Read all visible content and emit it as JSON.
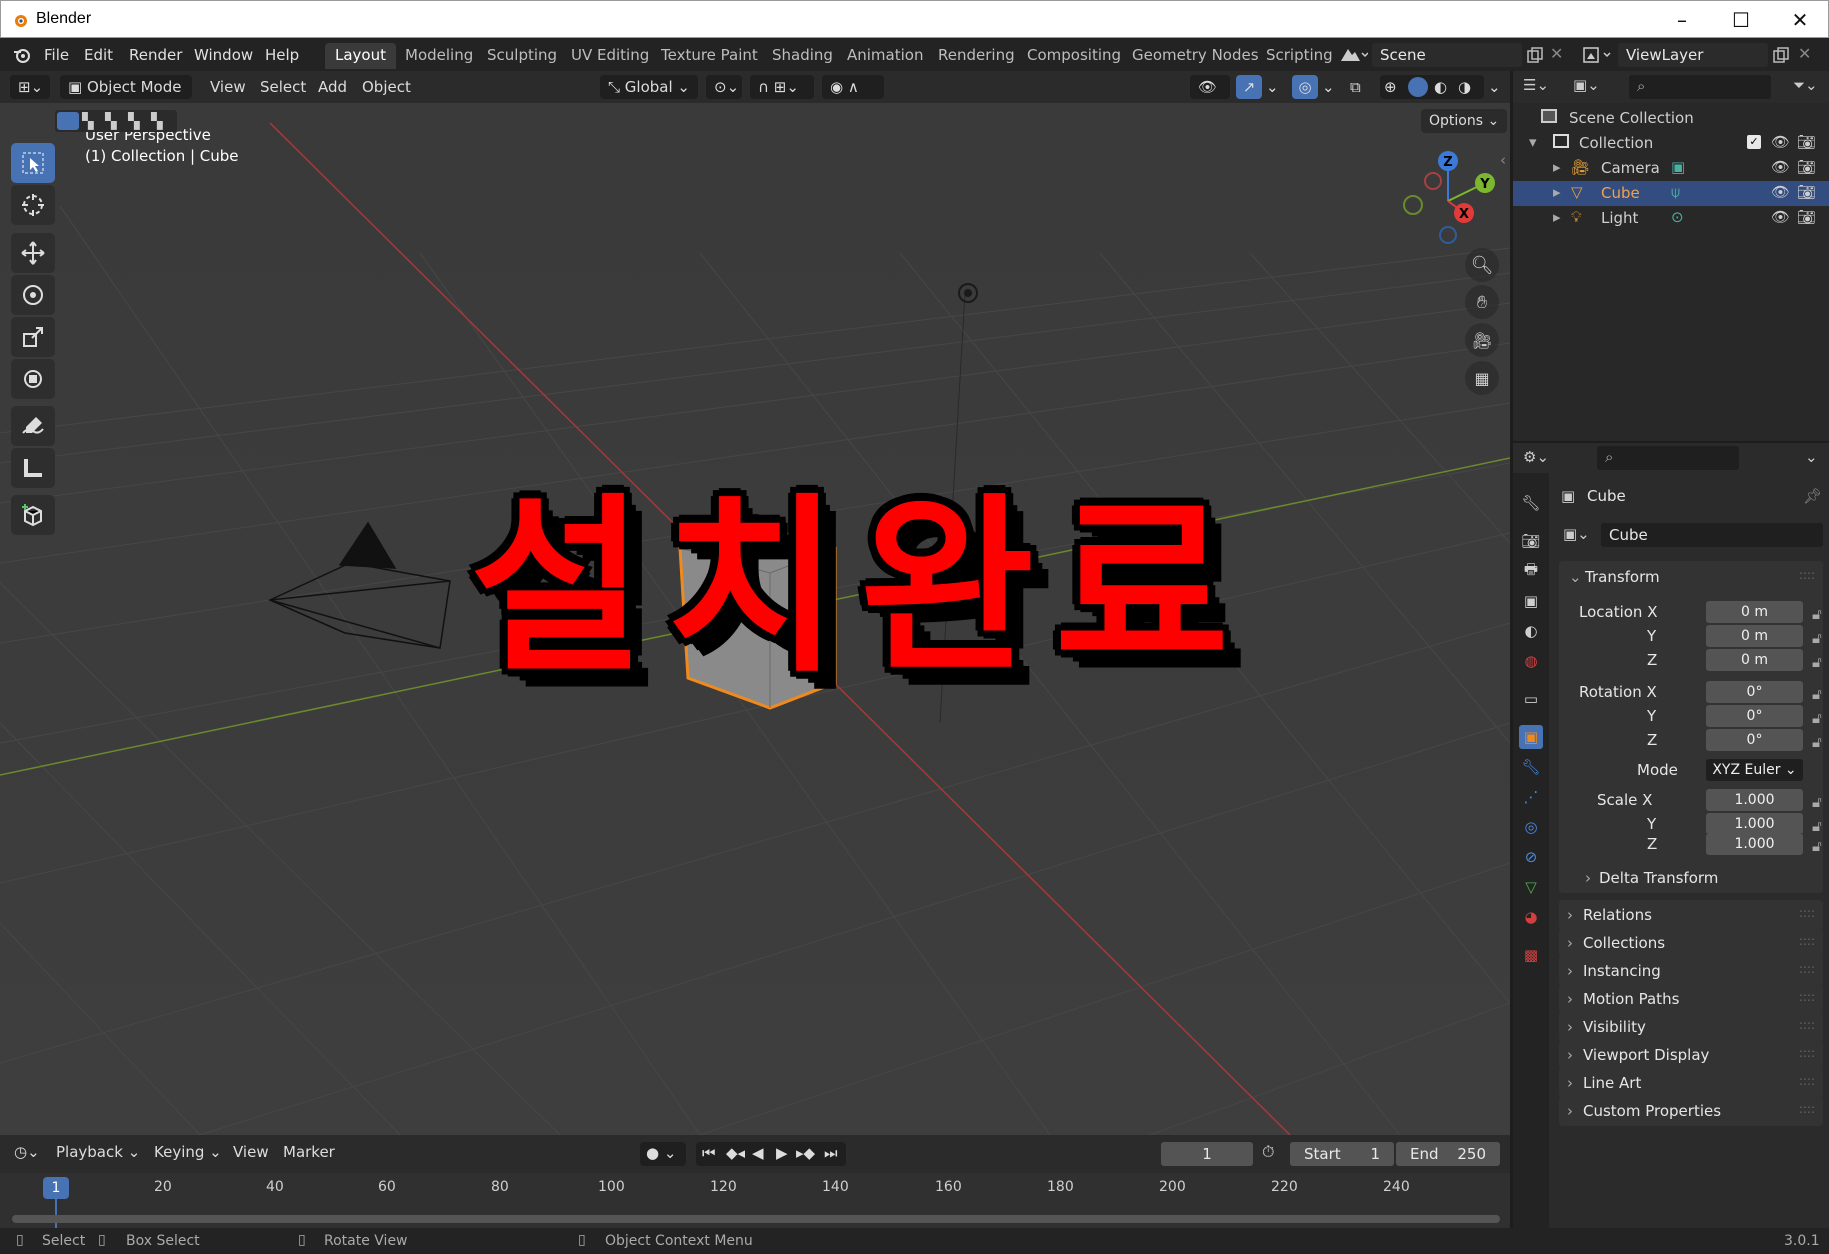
{
  "window": {
    "title": "Blender"
  },
  "menu": [
    "File",
    "Edit",
    "Render",
    "Window",
    "Help"
  ],
  "workspaces": [
    {
      "label": "Layout",
      "active": true
    },
    {
      "label": "Modeling"
    },
    {
      "label": "Sculpting"
    },
    {
      "label": "UV Editing"
    },
    {
      "label": "Texture Paint"
    },
    {
      "label": "Shading"
    },
    {
      "label": "Animation"
    },
    {
      "label": "Rendering"
    },
    {
      "label": "Compositing"
    },
    {
      "label": "Geometry Nodes"
    },
    {
      "label": "Scripting"
    }
  ],
  "scene": {
    "name": "Scene",
    "view_layer": "ViewLayer"
  },
  "viewport_header": {
    "mode": "Object Mode",
    "menus": [
      "View",
      "Select",
      "Add",
      "Object"
    ],
    "orientation": "Global",
    "options": "Options"
  },
  "viewport": {
    "perspective": "User Perspective",
    "context": "(1) Collection | Cube",
    "overlay_text": "설치완료",
    "gizmo_axes": [
      "Z",
      "Y",
      "X"
    ]
  },
  "outliner": {
    "root": "Scene Collection",
    "collection": "Collection",
    "items": [
      {
        "label": "Camera",
        "selected": false,
        "color": "#e8a33b"
      },
      {
        "label": "Cube",
        "selected": true,
        "color": "#e8a33b"
      },
      {
        "label": "Light",
        "selected": false,
        "color": "#e8a33b"
      }
    ]
  },
  "properties": {
    "object_name": "Cube",
    "mesh_name": "Cube",
    "transform_title": "Transform",
    "location_label": "Location X",
    "rotation_label": "Rotation X",
    "scale_label": "Scale X",
    "y_label": "Y",
    "z_label": "Z",
    "location": [
      "0 m",
      "0 m",
      "0 m"
    ],
    "rotation": [
      "0°",
      "0°",
      "0°"
    ],
    "mode_label": "Mode",
    "mode_value": "XYZ Euler",
    "scale": [
      "1.000",
      "1.000",
      "1.000"
    ],
    "delta_transform": "Delta Transform",
    "panels": [
      "Relations",
      "Collections",
      "Instancing",
      "Motion Paths",
      "Visibility",
      "Viewport Display",
      "Line Art",
      "Custom Properties"
    ]
  },
  "timeline": {
    "menus": [
      "Playback",
      "Keying",
      "View",
      "Marker"
    ],
    "current_frame": "1",
    "start_label": "Start",
    "start_value": "1",
    "end_label": "End",
    "end_value": "250",
    "ticks": [
      "1",
      "20",
      "40",
      "60",
      "80",
      "100",
      "120",
      "140",
      "160",
      "180",
      "200",
      "220",
      "240"
    ]
  },
  "statusbar": {
    "select": "Select",
    "box_select": "Box Select",
    "rotate_view": "Rotate View",
    "context_menu": "Object Context Menu",
    "version": "3.0.1"
  },
  "colors": {
    "accent": "#4772b3",
    "selection_orange": "#f08a1e",
    "overlay_red": "#ff0000"
  }
}
